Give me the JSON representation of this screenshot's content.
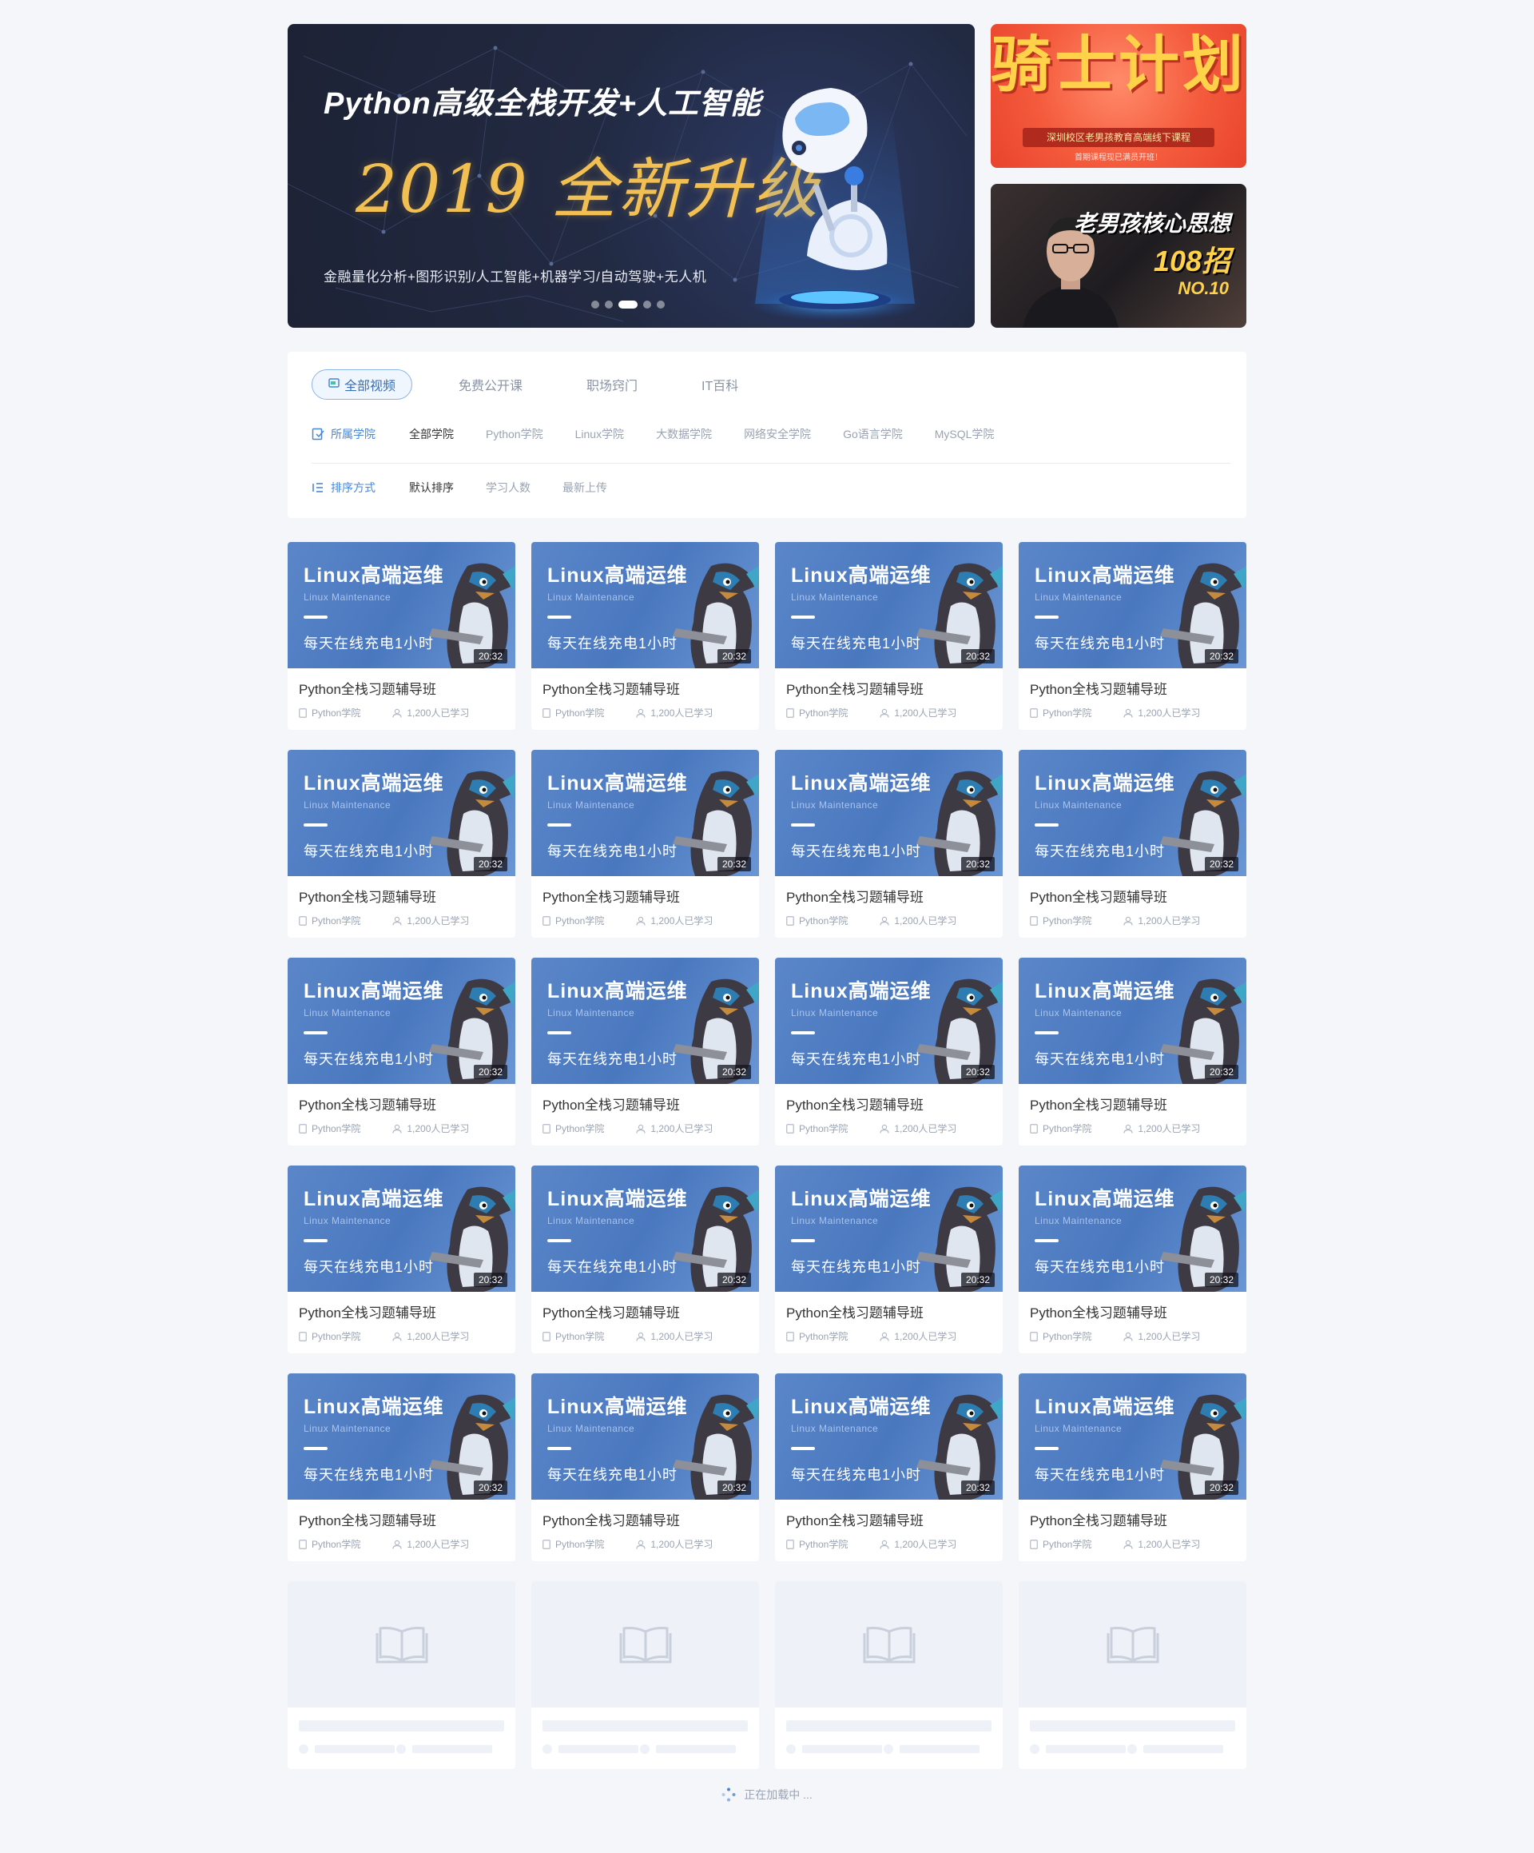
{
  "banner": {
    "title": "Python高级全栈开发+人工智能",
    "headline": "2019 全新升级",
    "subtitle": "金融量化分析+图形识别/人工智能+机器学习/自动驾驶+无人机",
    "slides": 5,
    "active_slide": 3
  },
  "side_ads": [
    {
      "title": "骑士计划",
      "ribbon": "深圳校区老男孩教育高端线下课程",
      "note": "首期课程现已满员开班！"
    },
    {
      "title": "老男孩核心思想",
      "big": "108招",
      "no": "NO.10"
    }
  ],
  "tabs": [
    {
      "label": "全部视频",
      "active": true
    },
    {
      "label": "免费公开课",
      "active": false
    },
    {
      "label": "职场窍门",
      "active": false
    },
    {
      "label": "IT百科",
      "active": false
    }
  ],
  "filters": {
    "college": {
      "label": "所属学院",
      "options": [
        "全部学院",
        "Python学院",
        "Linux学院",
        "大数据学院",
        "网络安全学院",
        "Go语言学院",
        "MySQL学院"
      ],
      "selected": "全部学院"
    },
    "sort": {
      "label": "排序方式",
      "options": [
        "默认排序",
        "学习人数",
        "最新上传"
      ],
      "selected": "默认排序"
    }
  },
  "course_card": {
    "thumb_title": "Linux高端运维",
    "thumb_subtitle": "Linux  Maintenance",
    "thumb_slogan": "每天在线充电1小时",
    "duration": "20:32",
    "title": "Python全栈习题辅导班",
    "college": "Python学院",
    "learners": "1,200人已学习"
  },
  "course_count": 20,
  "skeleton_count": 4,
  "loading_text": "正在加载中 ...",
  "colors": {
    "accent": "#4a86d6",
    "page_bg": "#f4f6fa",
    "thumb_blue": "#4f7ec4"
  }
}
